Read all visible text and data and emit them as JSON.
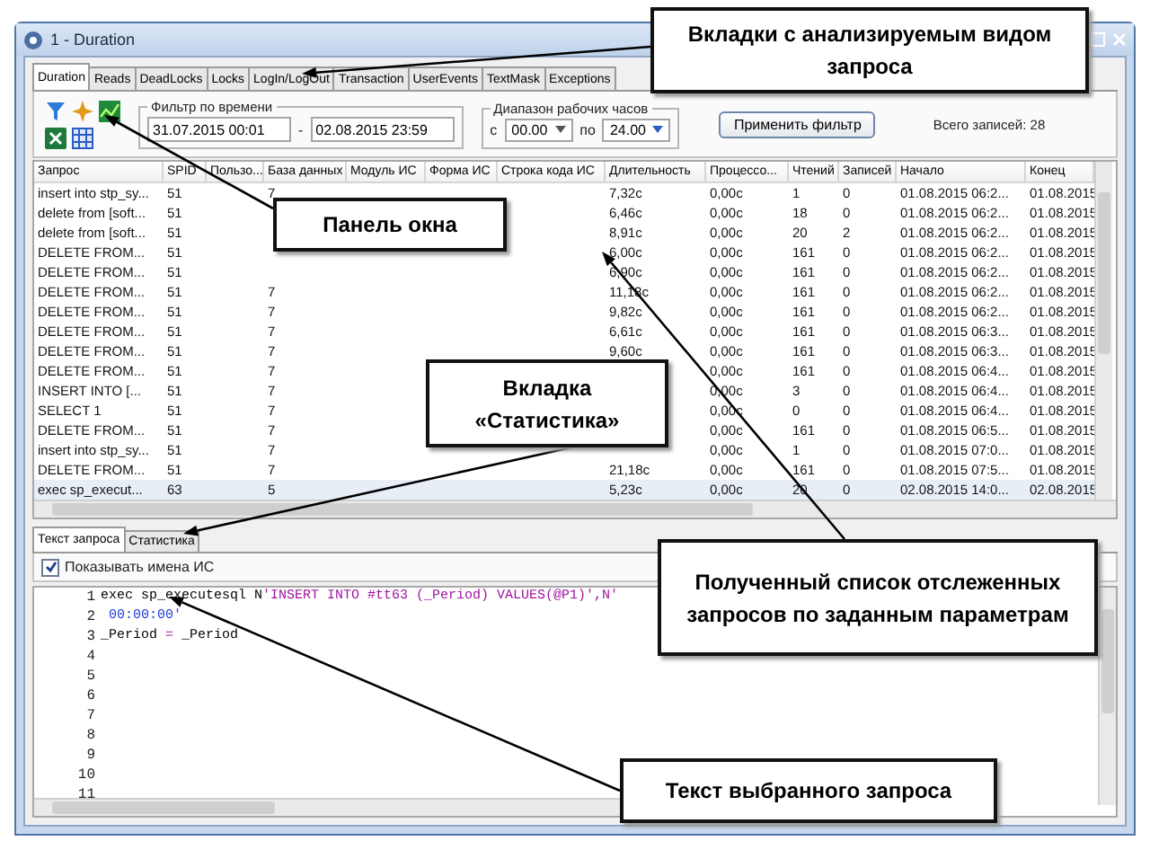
{
  "window": {
    "title": "1 - Duration"
  },
  "tabs": [
    {
      "label": "Duration",
      "selected": true
    },
    {
      "label": "Reads",
      "selected": false
    },
    {
      "label": "DeadLocks",
      "selected": false
    },
    {
      "label": "Locks",
      "selected": false
    },
    {
      "label": "LogIn/LogOut",
      "selected": false
    },
    {
      "label": "Transaction",
      "selected": false
    },
    {
      "label": "UserEvents",
      "selected": false
    },
    {
      "label": "TextMask",
      "selected": false
    },
    {
      "label": "Exceptions",
      "selected": false
    }
  ],
  "filter": {
    "time_label": "Фильтр по времени",
    "from": "31.07.2015 00:01",
    "separator": "-",
    "to": "02.08.2015 23:59",
    "hours_label": "Диапазон рабочих часов",
    "from_prefix": "с",
    "from_hour": "00.00",
    "to_prefix": "по",
    "to_hour": "24.00",
    "apply_button": "Применить фильтр",
    "total": "Всего записей: 28"
  },
  "table": {
    "columns": [
      "Запрос",
      "SPID",
      "Пользо...",
      "База данных",
      "Модуль ИС",
      "Форма ИС",
      "Строка кода ИС",
      "Длительность",
      "Процессо...",
      "Чтений",
      "Записей",
      "Начало",
      "Конец"
    ],
    "rows": [
      {
        "selected": false,
        "query": "insert into stp_sy...",
        "spid": "51",
        "database": "7",
        "duration": "7,32с",
        "cpu": "0,00с",
        "reads": "1",
        "writes": "0",
        "start": "01.08.2015 06:2...",
        "end": "01.08.2015"
      },
      {
        "selected": false,
        "query": "delete from [soft...",
        "spid": "51",
        "duration": "6,46с",
        "cpu": "0,00с",
        "reads": "18",
        "writes": "0",
        "start": "01.08.2015 06:2...",
        "end": "01.08.2015"
      },
      {
        "selected": false,
        "query": "delete from [soft...",
        "spid": "51",
        "duration": "8,91с",
        "cpu": "0,00с",
        "reads": "20",
        "writes": "2",
        "start": "01.08.2015 06:2...",
        "end": "01.08.2015"
      },
      {
        "selected": false,
        "query": "DELETE FROM...",
        "spid": "51",
        "duration": "6,00с",
        "cpu": "0,00с",
        "reads": "161",
        "writes": "0",
        "start": "01.08.2015 06:2...",
        "end": "01.08.2015"
      },
      {
        "selected": false,
        "query": "DELETE FROM...",
        "spid": "51",
        "duration": "6,90с",
        "cpu": "0,00с",
        "reads": "161",
        "writes": "0",
        "start": "01.08.2015 06:2...",
        "end": "01.08.2015"
      },
      {
        "selected": false,
        "query": "DELETE FROM...",
        "spid": "51",
        "database": "7",
        "duration": "11,18с",
        "cpu": "0,00с",
        "reads": "161",
        "writes": "0",
        "start": "01.08.2015 06:2...",
        "end": "01.08.2015"
      },
      {
        "selected": false,
        "query": "DELETE FROM...",
        "spid": "51",
        "database": "7",
        "duration": "9,82с",
        "cpu": "0,00с",
        "reads": "161",
        "writes": "0",
        "start": "01.08.2015 06:2...",
        "end": "01.08.2015"
      },
      {
        "selected": false,
        "query": "DELETE FROM...",
        "spid": "51",
        "database": "7",
        "duration": "6,61с",
        "cpu": "0,00с",
        "reads": "161",
        "writes": "0",
        "start": "01.08.2015 06:3...",
        "end": "01.08.2015"
      },
      {
        "selected": false,
        "query": "DELETE FROM...",
        "spid": "51",
        "database": "7",
        "duration": "9,60с",
        "cpu": "0,00с",
        "reads": "161",
        "writes": "0",
        "start": "01.08.2015 06:3...",
        "end": "01.08.2015"
      },
      {
        "selected": false,
        "query": "DELETE FROM...",
        "spid": "51",
        "database": "7",
        "cpu": "0,00с",
        "reads": "161",
        "writes": "0",
        "start": "01.08.2015 06:4...",
        "end": "01.08.2015"
      },
      {
        "selected": false,
        "query": "INSERT INTO [...",
        "spid": "51",
        "database": "7",
        "cpu": "0,00с",
        "reads": "3",
        "writes": "0",
        "start": "01.08.2015 06:4...",
        "end": "01.08.2015"
      },
      {
        "selected": false,
        "query": "SELECT 1",
        "spid": "51",
        "database": "7",
        "cpu": "0,00с",
        "reads": "0",
        "writes": "0",
        "start": "01.08.2015 06:4...",
        "end": "01.08.2015"
      },
      {
        "selected": false,
        "query": "DELETE FROM...",
        "spid": "51",
        "database": "7",
        "cpu": "0,00с",
        "reads": "161",
        "writes": "0",
        "start": "01.08.2015 06:5...",
        "end": "01.08.2015"
      },
      {
        "selected": false,
        "query": "insert into stp_sy...",
        "spid": "51",
        "database": "7",
        "cpu": "0,00с",
        "reads": "1",
        "writes": "0",
        "start": "01.08.2015 07:0...",
        "end": "01.08.2015"
      },
      {
        "selected": false,
        "query": "DELETE FROM...",
        "spid": "51",
        "database": "7",
        "duration": "21,18с",
        "cpu": "0,00с",
        "reads": "161",
        "writes": "0",
        "start": "01.08.2015 07:5...",
        "end": "01.08.2015"
      },
      {
        "selected": true,
        "query": "exec sp_execut...",
        "spid": "63",
        "database": "5",
        "duration": "5,23с",
        "cpu": "0,00с",
        "reads": "20",
        "writes": "0",
        "start": "02.08.2015 14:0...",
        "end": "02.08.2015"
      }
    ]
  },
  "detail_tabs": [
    {
      "label": "Текст запроса",
      "selected": true
    },
    {
      "label": "Статистика",
      "selected": false
    }
  ],
  "show_names": {
    "label": "Показывать имена ИС",
    "checked": true
  },
  "code_lines": [
    {
      "number": "1",
      "tokens": [
        {
          "text": "exec sp_executesql N",
          "kind": "plain"
        },
        {
          "text": "'INSERT INTO #tt63 (_Period) VALUES(@P1)',N'",
          "kind": "string"
        }
      ]
    },
    {
      "number": "2",
      "tokens": [
        {
          "text": " 00:00:00'",
          "kind": "value"
        }
      ]
    },
    {
      "number": "3",
      "tokens": [
        {
          "text": "_Period ",
          "kind": "plain"
        },
        {
          "text": "=",
          "kind": "string"
        },
        {
          "text": " _Period",
          "kind": "plain"
        }
      ]
    },
    {
      "number": "4"
    },
    {
      "number": "5"
    },
    {
      "number": "6"
    },
    {
      "number": "7"
    },
    {
      "number": "8"
    },
    {
      "number": "9"
    },
    {
      "number": "10"
    },
    {
      "number": "11"
    }
  ],
  "callouts": [
    {
      "text": "Вкладки с анализируемым видом запроса"
    },
    {
      "text": "Панель окна"
    },
    {
      "text": "Вкладка «Статистика»"
    },
    {
      "text": "Полученный список отслеженных запросов по заданным параметрам"
    },
    {
      "text": "Текст выбранного запроса"
    }
  ]
}
